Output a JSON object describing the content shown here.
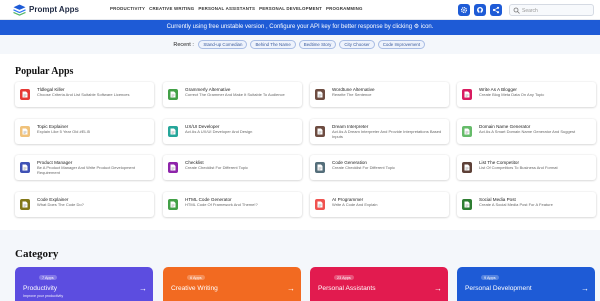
{
  "header": {
    "brand": "Prompt Apps",
    "nav": [
      "PRODUCTIVITY",
      "CREATIVE WRITING",
      "PERSONAL ASSISTANTS",
      "PERSONAL DEVELOPMENT",
      "PROGRAMMING"
    ],
    "search_placeholder": "Search",
    "icons": [
      "gear-icon",
      "github-icon",
      "share-icon",
      "search-icon"
    ]
  },
  "banner": "Currently using free unstable version , Configure your API key for better response by clicking ⚙ icon.",
  "recent": {
    "label": "Recent :",
    "chips": [
      "Stand-up Comedian",
      "Behind The Name",
      "Bedtime Story",
      "City Chooser",
      "Code Improvement"
    ]
  },
  "popular": {
    "title": "Popular Apps",
    "apps": [
      {
        "title": "Tldlegal Killer",
        "desc": "Choose Criteria And List Suitable Software Licences",
        "color": "#e53935"
      },
      {
        "title": "Grammerly Alternative",
        "desc": "Correct The Grammer And Make It Suitable To Audience",
        "color": "#43a047"
      },
      {
        "title": "Wordtune Alternative",
        "desc": "Rewrite The Sentence",
        "color": "#6d4c41"
      },
      {
        "title": "Write As A Blogger",
        "desc": "Create Blog Meta Data On Any Topic",
        "color": "#d81b60"
      },
      {
        "title": "Topic Explainer",
        "desc": "Explain Like 5 Year Old #ELI5",
        "color": "#f0c27b"
      },
      {
        "title": "UX/UI Developer",
        "desc": "Act As A UX/UI Developer And Design",
        "color": "#26a69a"
      },
      {
        "title": "Dream Interpreter",
        "desc": "Act As A Dream Interpreter And Provide Interpretations Based Inputs",
        "color": "#6d4c41"
      },
      {
        "title": "Domain Name Generator",
        "desc": "Act As A Smart Domain Name Generator And Suggest",
        "color": "#66bb6a"
      },
      {
        "title": "Product Manager",
        "desc": "Be A Product Manager And Write Product Development Requirement",
        "color": "#3f51b5"
      },
      {
        "title": "Checklist",
        "desc": "Create Checklist For Different Topic",
        "color": "#8e24aa"
      },
      {
        "title": "Code Generation",
        "desc": "Create Checklist For Different Topic",
        "color": "#546e7a"
      },
      {
        "title": "List The Competitor",
        "desc": "List Of Competitors To Business And Format",
        "color": "#5d4037"
      },
      {
        "title": "Code Explainer",
        "desc": "What Does The Code Do?",
        "color": "#827717"
      },
      {
        "title": "HTML Code Generator",
        "desc": "HTML Code Of Framework And Theme!?",
        "color": "#43a047"
      },
      {
        "title": "AI Programmer",
        "desc": "Write A Code And Explain",
        "color": "#ef5350"
      },
      {
        "title": "Social Media Post",
        "desc": "Create A Social Media Post For A Feature",
        "color": "#2e7d32"
      }
    ]
  },
  "category": {
    "title": "Category",
    "items": [
      {
        "name": "Productivity",
        "badge": "7 Apps",
        "desc": "Improve your productivity",
        "color": "#5c4de0"
      },
      {
        "name": "Creative Writing",
        "badge": "6 Apps",
        "desc": "",
        "color": "#f26a21"
      },
      {
        "name": "Personal Assistants",
        "badge": "23 Apps",
        "desc": "",
        "color": "#e21b4f"
      },
      {
        "name": "Personal Development",
        "badge": "9 Apps",
        "desc": "",
        "color": "#1e5bd6"
      }
    ]
  }
}
